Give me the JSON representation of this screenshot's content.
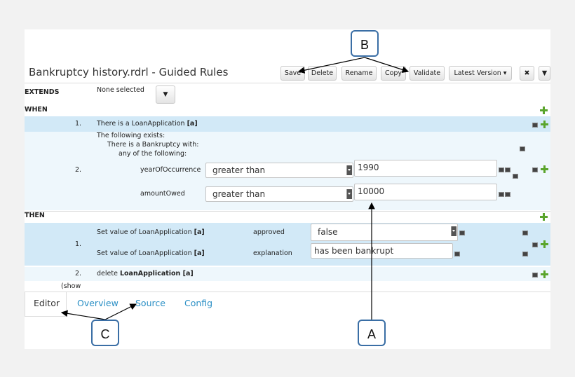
{
  "header": {
    "title": "Bankruptcy history.rdrl - Guided Rules",
    "buttons": {
      "save": "Save",
      "delete": "Delete",
      "rename": "Rename",
      "copy": "Copy",
      "validate": "Validate",
      "latest_version": "Latest Version",
      "close": "✖",
      "more": "▼"
    }
  },
  "extends": {
    "label": "EXTENDS",
    "value": "None selected"
  },
  "when": {
    "label": "WHEN",
    "rule1": {
      "num": "1.",
      "text": "There is a LoanApplication",
      "var": "[a]"
    },
    "rule2": {
      "num": "2.",
      "line1": "The following exists:",
      "line2": "There is a Bankruptcy with:",
      "line3": "any of the following:",
      "field1": {
        "name": "yearOfOccurrence",
        "operator": "greater than",
        "value": "1990"
      },
      "field2": {
        "name": "amountOwed",
        "operator": "greater than",
        "value": "10000"
      }
    }
  },
  "then": {
    "label": "THEN",
    "action1": {
      "num": "1.",
      "row1": {
        "text": "Set value of LoanApplication",
        "var": "[a]",
        "field": "approved",
        "value": "false"
      },
      "row2": {
        "text": "Set value of LoanApplication",
        "var": "[a]",
        "field": "explanation",
        "value": "has been bankrupt"
      }
    },
    "action2": {
      "num": "2.",
      "text": "delete",
      "target": "LoanApplication [a]"
    }
  },
  "show": "(show",
  "tabs": {
    "editor": "Editor",
    "overview": "Overview",
    "source": "Source",
    "config": "Config"
  },
  "callouts": {
    "a": "A",
    "b": "B",
    "c": "C"
  }
}
